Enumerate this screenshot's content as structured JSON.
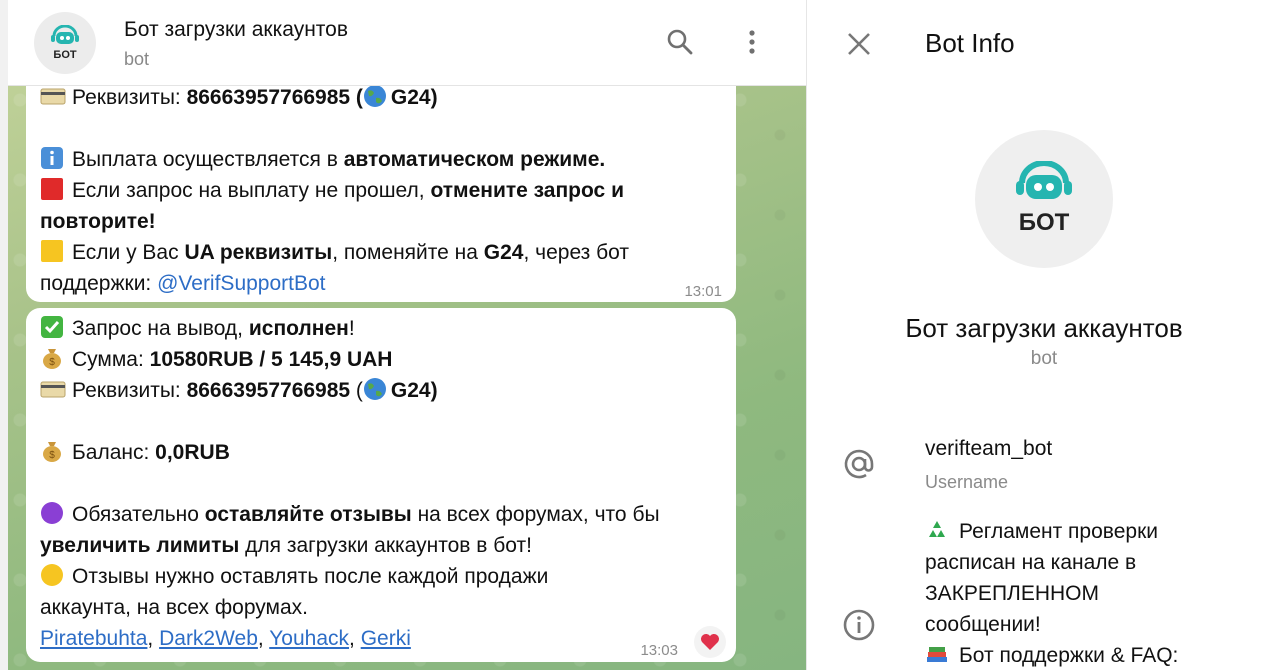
{
  "header": {
    "title": "Бот загрузки аккаунтов",
    "subtitle": "bot",
    "avatar_text": "БОТ"
  },
  "message1": {
    "line1_prefix": "Реквизиты: ",
    "line1_value": "86663957766985 (",
    "line1_suffix": "G24)",
    "line2_text": "Выплата осуществляется в ",
    "line2_bold": "автоматическом режиме.",
    "line3_text": "Если запрос на выплату не прошел, ",
    "line3_bold": "отмените запрос и",
    "line4_bold": "повторите!",
    "line5_a": "Если у Вас ",
    "line5_bold1": "UA реквизиты",
    "line5_b": ", поменяйте на ",
    "line5_bold2": "G24",
    "line5_c": ", через бот",
    "line6_text": "поддержки: ",
    "line6_link": "@VerifSupportBot",
    "time": "13:01"
  },
  "message2": {
    "l1_text": "Запрос на вывод, ",
    "l1_bold": "исполнен",
    "l1_end": "!",
    "l2_text": "Сумма: ",
    "l2_bold": "10580RUB  / 5 145,9 UAH",
    "l3_text": "Реквизиты: ",
    "l3_bold": "86663957766985",
    "l3_open": " (",
    "l3_suffix": "G24)",
    "l4_text": "Баланс: ",
    "l4_bold": "0,0RUB",
    "l5_text": "Обязательно ",
    "l5_bold": "оставляйте отзывы",
    "l5_end": " на всех форумах, что бы",
    "l6_bold": "увеличить лимиты",
    "l6_end": " для загрузки аккаунтов в бот!",
    "l7_text": "Отзывы нужно оставлять после каждой продажи",
    "l8_text": "аккаунта, на всех форумах.",
    "links": [
      "Piratebuhta",
      "Dark2Web",
      "Youhack",
      "Gerki"
    ],
    "time": "13:03"
  },
  "panel": {
    "title": "Bot Info",
    "avatar_text": "БОТ",
    "name": "Бот загрузки аккаунтов",
    "sub": "bot",
    "username": "verifteam_bot",
    "username_label": "Username",
    "desc1": "Регламент проверки",
    "desc2": "расписан на канале в",
    "desc3": "ЗАКРЕПЛЕННОМ",
    "desc4": "сообщении!",
    "desc5": "Бот поддержки & FAQ:"
  },
  "colors": {
    "link": "#2d6dc6",
    "bot_icon": "#25b5b0",
    "heart": "#e0314b"
  }
}
